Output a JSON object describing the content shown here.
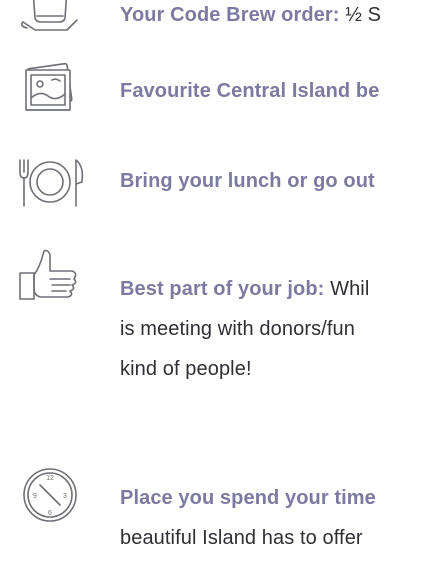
{
  "items": [
    {
      "icon": "coffee-cup-icon",
      "label": "Your Code Brew order:",
      "value": "½ S"
    },
    {
      "icon": "landscape-photo-icon",
      "label": "Favourite Central Island be",
      "value": ""
    },
    {
      "icon": "plate-and-cutlery-icon",
      "label": "Bring your lunch or go out",
      "value": ""
    },
    {
      "icon": "thumbs-up-icon",
      "label": "Best part of your job:",
      "value": "Whil",
      "continuation": [
        "is meeting with donors/fun",
        "kind of people!"
      ]
    },
    {
      "icon": "clock-icon",
      "label": "Place you spend your time",
      "value": "",
      "continuation": [
        "beautiful Island has to offer"
      ]
    }
  ],
  "colors": {
    "label": "#7c7aa0",
    "body_text": "#2f2f36",
    "icon_stroke": "#6f6f78"
  }
}
